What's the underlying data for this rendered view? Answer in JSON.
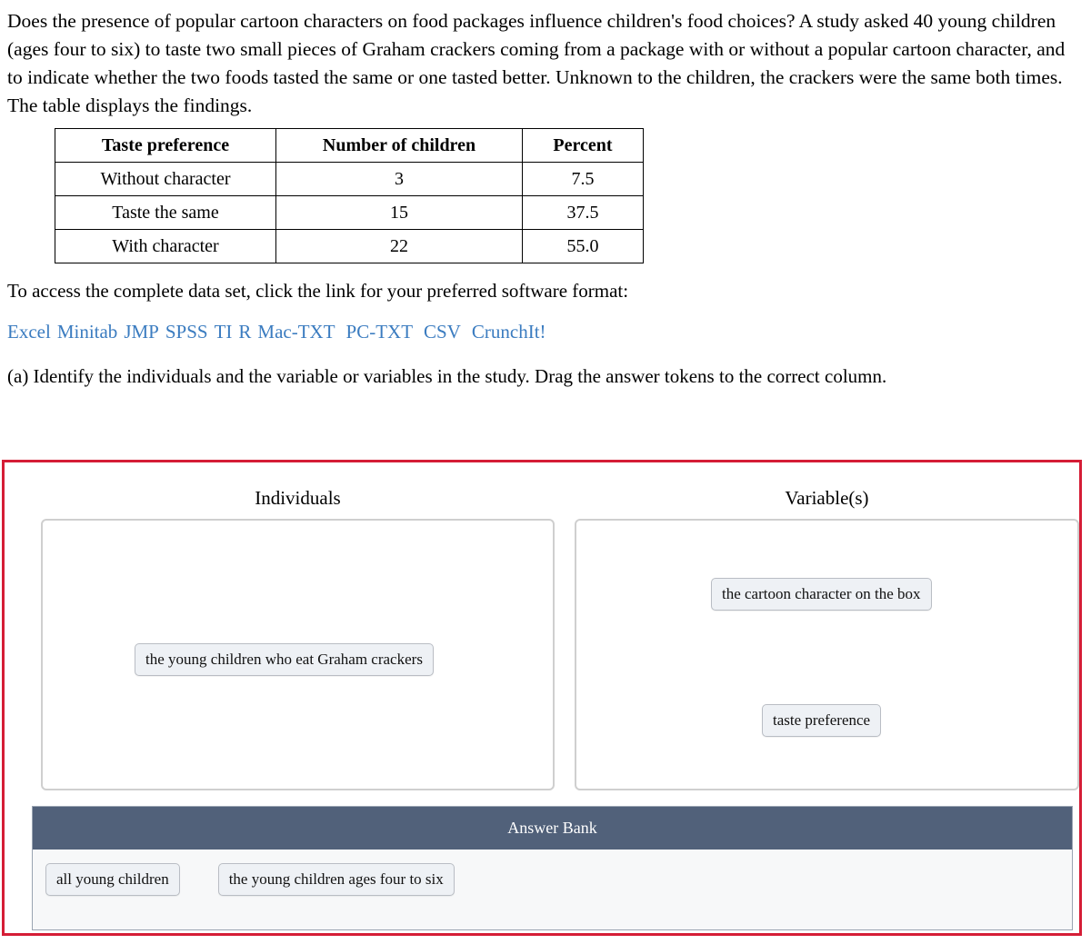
{
  "intro": {
    "paragraph": "Does the presence of popular cartoon characters on food packages influence children's food choices? A study asked 40 young children (ages four to six) to taste two small pieces of Graham crackers coming from a package with or without a popular cartoon character, and to indicate whether the two foods tasted the same or one tasted better. Unknown to the children, the crackers were the same both times. The table displays the findings."
  },
  "table": {
    "headers": [
      "Taste preference",
      "Number of children",
      "Percent"
    ],
    "rows": [
      [
        "Without character",
        "3",
        "7.5"
      ],
      [
        "Taste the same",
        "15",
        "37.5"
      ],
      [
        "With character",
        "22",
        "55.0"
      ]
    ]
  },
  "access": {
    "line": "To access the complete data set, click the link for your preferred software format:",
    "links": [
      "Excel",
      "Minitab",
      "JMP",
      "SPSS",
      "TI",
      "R",
      "Mac-TXT",
      "PC-TXT",
      "CSV",
      "CrunchIt!"
    ],
    "link_color": "#3b7cc0"
  },
  "question": {
    "text": "(a) Identify the individuals and the variable or variables in the study. Drag the answer tokens to the correct column."
  },
  "dnd": {
    "border_color": "#d51d36",
    "columns": [
      {
        "title": "Individuals",
        "tokens": [
          "the young children who eat Graham crackers"
        ]
      },
      {
        "title": "Variable(s)",
        "tokens": [
          "the cartoon character on the box",
          "taste preference"
        ]
      }
    ],
    "answer_bank": {
      "title": "Answer Bank",
      "header_color": "#51617a",
      "tokens": [
        "all young children",
        "the young children ages four to six"
      ]
    }
  }
}
